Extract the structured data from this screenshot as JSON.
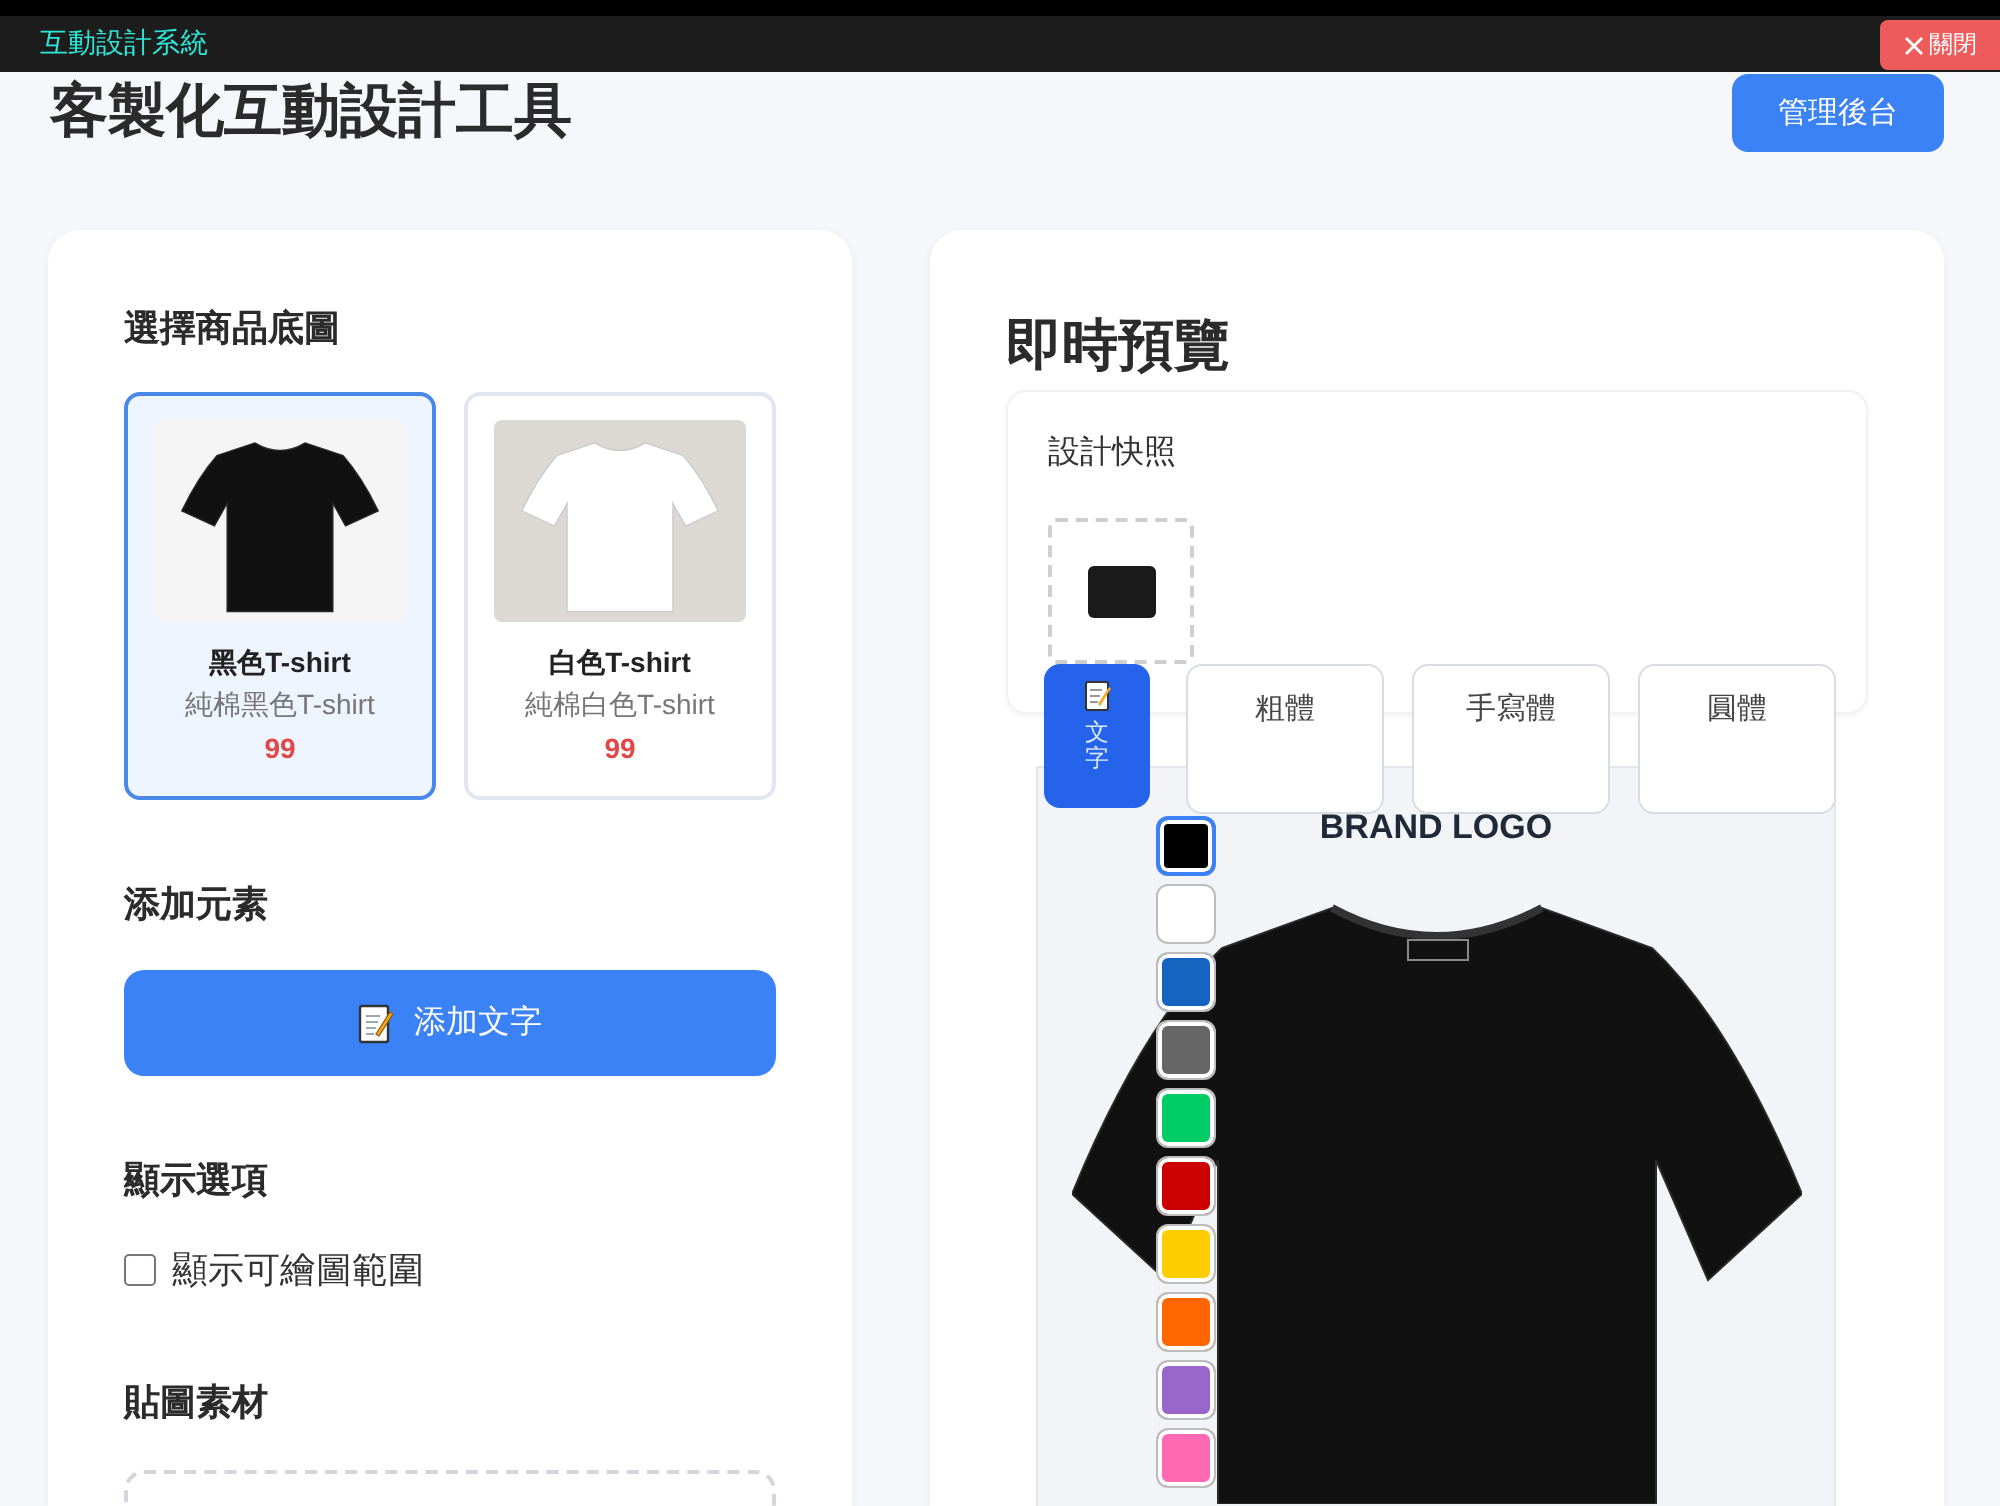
{
  "window": {
    "title": "互動設計系統",
    "close_label": "關閉"
  },
  "header": {
    "title": "客製化互動設計工具",
    "admin_button": "管理後台"
  },
  "product_section": {
    "heading": "選擇商品底圖",
    "products": [
      {
        "name": "黑色T-shirt",
        "description": "純棉黑色T-shirt",
        "price": "99",
        "kind": "dark",
        "selected": true
      },
      {
        "name": "白色T-shirt",
        "description": "純棉白色T-shirt",
        "price": "99",
        "kind": "light",
        "selected": false
      }
    ]
  },
  "add_element": {
    "heading": "添加元素",
    "button": "添加文字"
  },
  "display_options": {
    "heading": "顯示選項",
    "options": [
      {
        "label": "顯示可繪圖範圍",
        "checked": false
      }
    ]
  },
  "stickers": {
    "heading": "貼圖素材"
  },
  "preview": {
    "heading": "即時預覽",
    "snapshot": {
      "heading": "設計快照"
    },
    "text_tool": "文字",
    "font_options": [
      {
        "label": "粗體"
      },
      {
        "label": "手寫體"
      },
      {
        "label": "圓體"
      }
    ],
    "logo_text": "BRAND LOGO",
    "swatches": [
      {
        "color": "#000000",
        "selected": true
      },
      {
        "color": "#ffffff",
        "selected": false
      },
      {
        "color": "#1565c0",
        "selected": false
      },
      {
        "color": "#666666",
        "selected": false
      },
      {
        "color": "#00cc66",
        "selected": false
      },
      {
        "color": "#cc0000",
        "selected": false
      },
      {
        "color": "#ffcc00",
        "selected": false
      },
      {
        "color": "#ff6600",
        "selected": false
      },
      {
        "color": "#9966cc",
        "selected": false
      },
      {
        "color": "#ff69b4",
        "selected": false
      }
    ]
  }
}
